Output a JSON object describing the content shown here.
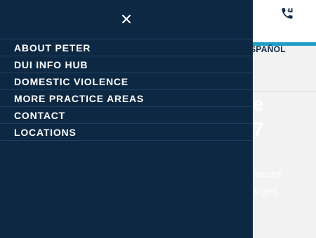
{
  "menu": {
    "close_icon": "close-icon",
    "items": [
      {
        "label": "ABOUT PETER"
      },
      {
        "label": "DUI INFO HUB"
      },
      {
        "label": "DOMESTIC VIOLENCE"
      },
      {
        "label": "MORE PRACTICE AREAS"
      },
      {
        "label": "CONTACT"
      },
      {
        "label": "LOCATIONS"
      }
    ]
  },
  "header": {
    "phone_icon": "phone-icon",
    "language_link": "SPAÑOL"
  },
  "hero": {
    "line1": "e",
    "line2": "7",
    "copy_line1": "record",
    "copy_line2": "arges"
  },
  "colors": {
    "drawer_bg": "#0d2843",
    "accent": "#1f9fc8",
    "page_bg": "#f2f2f2",
    "header_bg": "#ffffff"
  }
}
